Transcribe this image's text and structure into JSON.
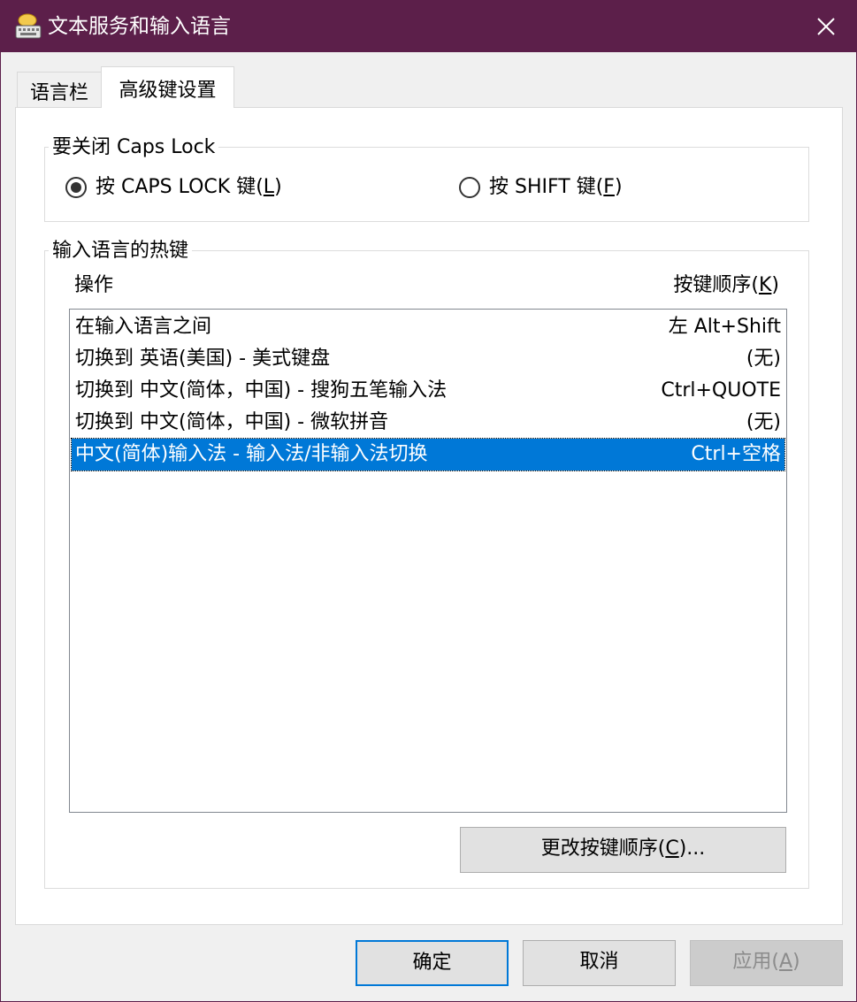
{
  "window": {
    "title": "文本服务和输入语言",
    "title_icon": "keyboard-icon",
    "close_icon": "close-icon",
    "titlebar_color": "#5c1f4a"
  },
  "tabs": [
    {
      "label": "语言栏",
      "active": false
    },
    {
      "label": "高级键设置",
      "active": true
    }
  ],
  "caps_group": {
    "label": "要关闭 Caps Lock",
    "options": [
      {
        "label_prefix": "按 CAPS LOCK 键(",
        "accel": "L",
        "label_suffix": ")",
        "selected": true
      },
      {
        "label_prefix": "按 SHIFT 键(",
        "accel": "F",
        "label_suffix": ")",
        "selected": false
      }
    ]
  },
  "hotkey_group": {
    "label": "输入语言的热键",
    "col_action": "操作",
    "col_keys_prefix": "按键顺序(",
    "col_keys_accel": "K",
    "col_keys_suffix": ")",
    "rows": [
      {
        "action": "在输入语言之间",
        "keys": "左 Alt+Shift",
        "selected": false
      },
      {
        "action": "切换到 英语(美国) - 美式键盘",
        "keys": "(无)",
        "selected": false
      },
      {
        "action": "切换到 中文(简体，中国) - 搜狗五笔输入法",
        "keys": "Ctrl+QUOTE",
        "selected": false
      },
      {
        "action": "切换到 中文(简体，中国) - 微软拼音",
        "keys": "(无)",
        "selected": false
      },
      {
        "action": "中文(简体)输入法 - 输入法/非输入法切换",
        "keys": "Ctrl+空格",
        "selected": true
      }
    ],
    "change_button": {
      "prefix": "更改按键顺序(",
      "accel": "C",
      "suffix": ")..."
    }
  },
  "footer": {
    "ok": "确定",
    "cancel": "取消",
    "apply_prefix": "应用(",
    "apply_accel": "A",
    "apply_suffix": ")",
    "apply_disabled": true
  },
  "colors": {
    "selection": "#0078d7",
    "default_button_border": "#0078d7"
  }
}
